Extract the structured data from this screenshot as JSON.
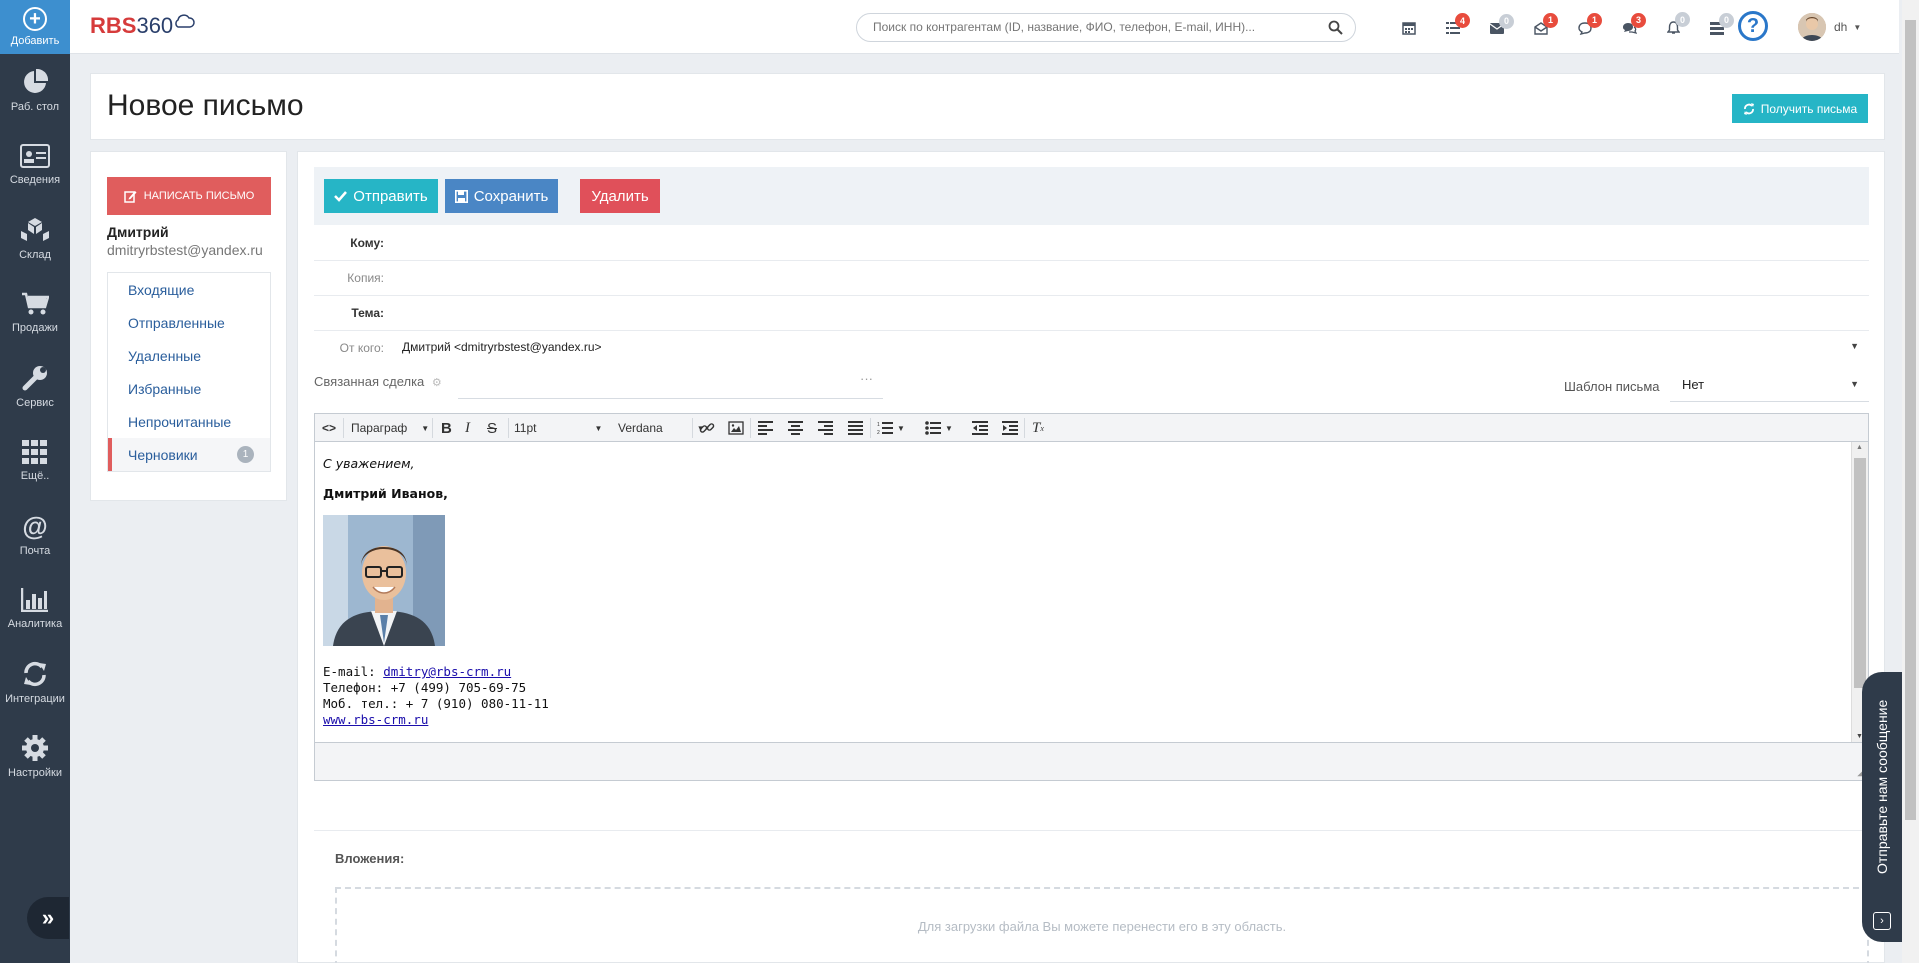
{
  "sidebar": {
    "add_label": "Добавить",
    "items": [
      {
        "label": "Раб. стол",
        "icon": "pie-chart-icon"
      },
      {
        "label": "Сведения",
        "icon": "id-card-icon"
      },
      {
        "label": "Склад",
        "icon": "boxes-icon"
      },
      {
        "label": "Продажи",
        "icon": "cart-icon"
      },
      {
        "label": "Сервис",
        "icon": "wrench-icon"
      },
      {
        "label": "Ещё..",
        "icon": "grid-icon"
      },
      {
        "label": "Почта",
        "icon": "at-icon"
      },
      {
        "label": "Аналитика",
        "icon": "bar-chart-icon"
      },
      {
        "label": "Интеграции",
        "icon": "refresh-icon"
      },
      {
        "label": "Настройки",
        "icon": "gear-icon"
      }
    ]
  },
  "header": {
    "logo_rbs": "RBS",
    "logo_num": "360",
    "search_placeholder": "Поиск по контрагентам (ID, название, ФИО, телефон, E-mail, ИНН)...",
    "badges": {
      "calendar": "",
      "tasks": "4",
      "mail": "0",
      "mail_open": "1",
      "chat": "1",
      "comments": "3",
      "bell": "0",
      "stack": "0"
    },
    "user": "dh"
  },
  "page": {
    "title": "Новое письмо",
    "fetch_button": "Получить письма"
  },
  "mailbox": {
    "write_button": "НАПИСАТЬ ПИСЬМО",
    "account_name": "Дмитрий",
    "account_email": "dmitryrbstest@yandex.ru",
    "folders": [
      "Входящие",
      "Отправленные",
      "Удаленные",
      "Избранные",
      "Непрочитанные",
      "Черновики"
    ],
    "drafts_count": "1"
  },
  "compose": {
    "send": "Отправить",
    "save": "Сохранить",
    "delete": "Удалить",
    "to_label": "Кому:",
    "cc_label": "Копия:",
    "subject_label": "Тема:",
    "from_label": "От кого:",
    "from_value": "Дмитрий <dmitryrbstest@yandex.ru>",
    "linked_deal_label": "Связанная сделка",
    "linked_dots": "···",
    "template_label": "Шаблон письма",
    "template_value": "Нет"
  },
  "editor": {
    "block_format": "Параграф",
    "font_size": "11pt",
    "font_family": "Verdana",
    "greeting": "С уважением,",
    "signature_name": "Дмитрий Иванов,",
    "email_prefix": "E-mail: ",
    "email_link": "dmitry@rbs-crm.ru",
    "phone": "Телефон: +7 (499) 705-69-75",
    "mobile": "Моб. тел.: + 7 (910) 080-11-11",
    "website": "www.rbs-crm.ru"
  },
  "attachments": {
    "label": "Вложения:",
    "dropzone_text": "Для загрузки файла Вы можете перенести его в эту область."
  },
  "chat_widget": {
    "label": "Отправьте нам сообщение"
  }
}
